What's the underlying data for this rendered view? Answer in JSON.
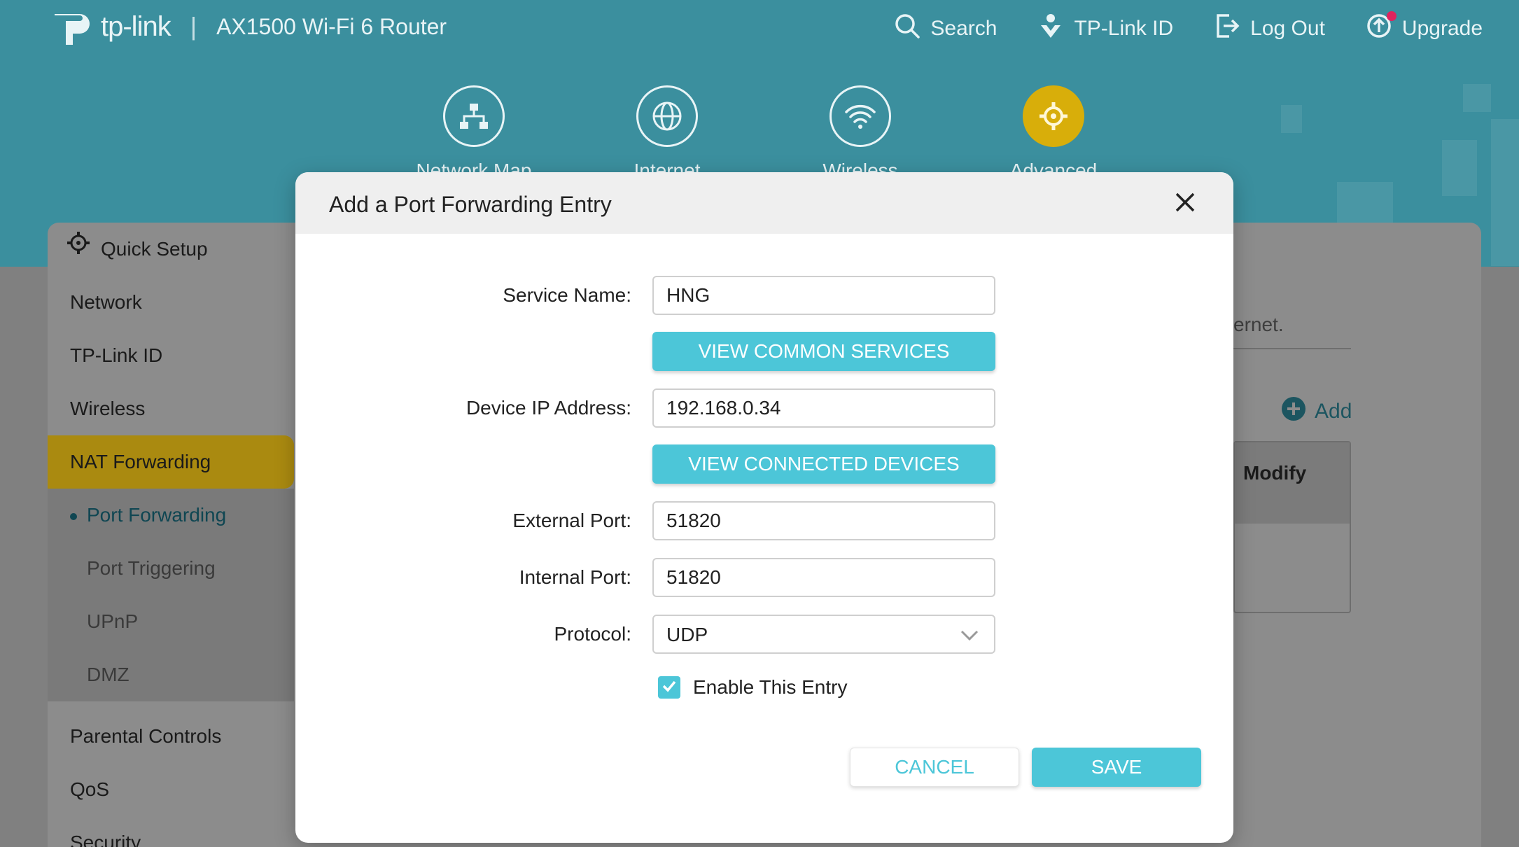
{
  "header": {
    "brand": "tp-link",
    "separator": "|",
    "model": "AX1500 Wi-Fi 6 Router",
    "links": [
      {
        "label": "Search",
        "icon": "search-icon"
      },
      {
        "label": "TP-Link ID",
        "icon": "tplink-id-icon"
      },
      {
        "label": "Log Out",
        "icon": "logout-icon"
      },
      {
        "label": "Upgrade",
        "icon": "upgrade-icon"
      }
    ]
  },
  "main_nav": [
    {
      "label": "Network Map",
      "icon": "network-map-icon"
    },
    {
      "label": "Internet",
      "icon": "globe-icon"
    },
    {
      "label": "Wireless",
      "icon": "wifi-icon"
    },
    {
      "label": "Advanced",
      "icon": "gear-icon",
      "active": true
    }
  ],
  "sidebar": {
    "items": [
      {
        "label": "Quick Setup"
      },
      {
        "label": "Network"
      },
      {
        "label": "TP-Link ID"
      },
      {
        "label": "Wireless"
      },
      {
        "label": "NAT Forwarding",
        "active": true
      }
    ],
    "sub_items": [
      {
        "label": "Port Forwarding",
        "current": true
      },
      {
        "label": "Port Triggering"
      },
      {
        "label": "UPnP"
      },
      {
        "label": "DMZ"
      }
    ],
    "items_after": [
      {
        "label": "Parental Controls"
      },
      {
        "label": "QoS"
      },
      {
        "label": "Security"
      }
    ]
  },
  "content": {
    "partial_text": "ernet.",
    "add_label": "Add",
    "table_header_modify": "Modify"
  },
  "modal": {
    "title": "Add a Port Forwarding Entry",
    "service_name_label": "Service Name:",
    "service_name_value": "HNG",
    "view_common_services": "VIEW COMMON SERVICES",
    "device_ip_label": "Device IP Address:",
    "device_ip_value": "192.168.0.34",
    "view_connected_devices": "VIEW CONNECTED DEVICES",
    "external_port_label": "External Port:",
    "external_port_value": "51820",
    "internal_port_label": "Internal Port:",
    "internal_port_value": "51820",
    "protocol_label": "Protocol:",
    "protocol_value": "UDP",
    "enable_label": "Enable This Entry",
    "enable_checked": true,
    "cancel_label": "CANCEL",
    "save_label": "SAVE"
  },
  "colors": {
    "header_teal": "#3b8f9e",
    "accent_teal": "#4cc6d8",
    "active_gold": "#d8ae0a",
    "overlay_gray": "#808080"
  }
}
